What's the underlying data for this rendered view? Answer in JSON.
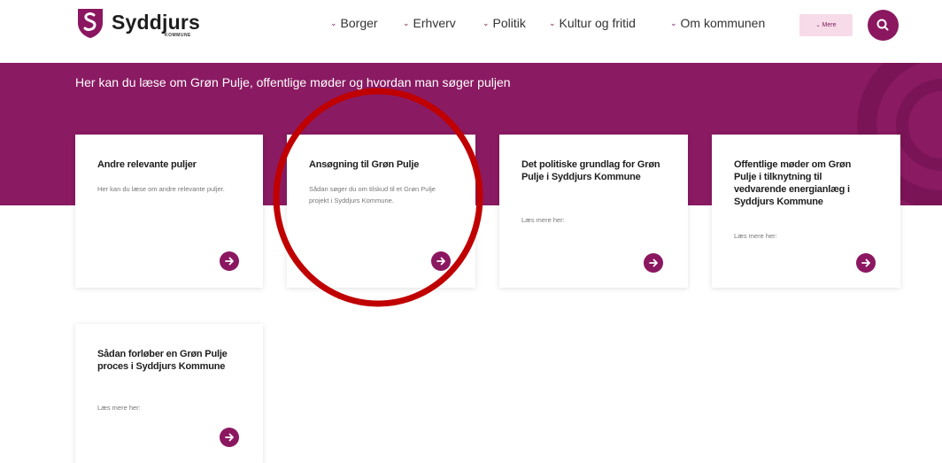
{
  "header": {
    "logo": {
      "name": "Syddjurs",
      "sub": "KOMMUNE"
    },
    "nav": [
      {
        "label": "Borger"
      },
      {
        "label": "Erhverv"
      },
      {
        "label": "Politik"
      },
      {
        "label": "Kultur og fritid"
      },
      {
        "label": "Om kommunen"
      }
    ],
    "more_label": "Mere",
    "search_icon": "search-icon"
  },
  "hero": {
    "text": "Her kan du læse om Grøn Pulje, offentlige møder og hvordan man søger puljen"
  },
  "cards": [
    {
      "title": "Andre relevante puljer",
      "desc": "Her kan du læse om andre relevante puljer."
    },
    {
      "title": "Ansøgning til Grøn Pulje",
      "desc": "Sådan søger du om tilskud til et Grøn Pulje projekt i Syddjurs Kommune."
    },
    {
      "title": "Det politiske grundlag for Grøn Pulje i Syddjurs Kommune",
      "desc": "Læs mere her:"
    },
    {
      "title": "Offentlige møder om Grøn Pulje i tilknytning til vedvarende energianlæg i Syddjurs Kommune",
      "desc": "Læs mere her:"
    },
    {
      "title": "Sådan forløber en Grøn Pulje proces i Syddjurs Kommune",
      "desc": "Læs mere her:"
    }
  ],
  "colors": {
    "brand": "#8a1a62",
    "accent_button": "#8b1760",
    "more_bg": "#f7dbe8",
    "annotation": "#c00000"
  }
}
